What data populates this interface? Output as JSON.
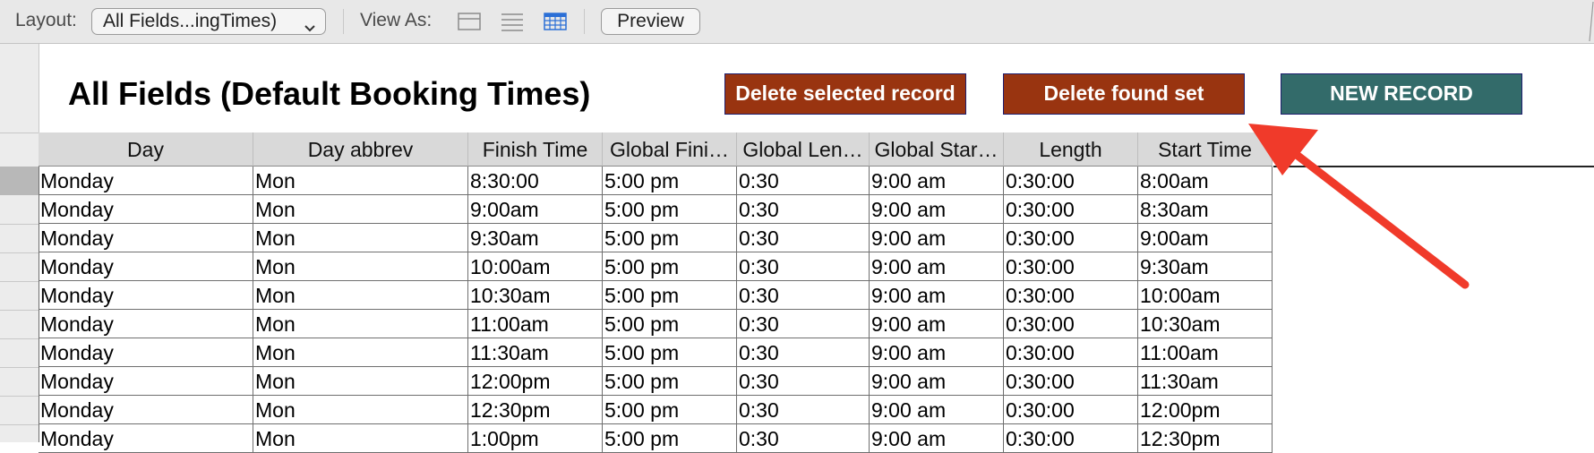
{
  "toolbar": {
    "layout_label": "Layout:",
    "layout_value": "All Fields...ingTimes)",
    "view_as_label": "View As:",
    "view_modes": [
      "form-view-icon",
      "list-view-icon",
      "table-view-icon"
    ],
    "selected_view": "table",
    "preview_label": "Preview"
  },
  "header": {
    "title": "All Fields (Default Booking Times)",
    "buttons": {
      "delete_selected": "Delete selected record",
      "delete_found": "Delete found set",
      "new_record": "NEW RECORD"
    }
  },
  "colors": {
    "delete_button_bg": "#993410",
    "new_record_bg": "#336b6a",
    "button_border": "#1e1e6e",
    "selected_view_icon": "#2b6fd6",
    "annotation_arrow": "#f03a2a"
  },
  "table": {
    "columns": [
      "Day",
      "Day abbrev",
      "Finish Time",
      "Global Fini…",
      "Global Len…",
      "Global Star…",
      "Length",
      "Start Time"
    ],
    "rows": [
      [
        "Monday",
        "Mon",
        "8:30:00",
        "5:00 pm",
        "0:30",
        "9:00 am",
        "0:30:00",
        "8:00am"
      ],
      [
        "Monday",
        "Mon",
        "9:00am",
        "5:00 pm",
        "0:30",
        "9:00 am",
        "0:30:00",
        "8:30am"
      ],
      [
        "Monday",
        "Mon",
        "9:30am",
        "5:00 pm",
        "0:30",
        "9:00 am",
        "0:30:00",
        "9:00am"
      ],
      [
        "Monday",
        "Mon",
        "10:00am",
        "5:00 pm",
        "0:30",
        "9:00 am",
        "0:30:00",
        "9:30am"
      ],
      [
        "Monday",
        "Mon",
        "10:30am",
        "5:00 pm",
        "0:30",
        "9:00 am",
        "0:30:00",
        "10:00am"
      ],
      [
        "Monday",
        "Mon",
        "11:00am",
        "5:00 pm",
        "0:30",
        "9:00 am",
        "0:30:00",
        "10:30am"
      ],
      [
        "Monday",
        "Mon",
        "11:30am",
        "5:00 pm",
        "0:30",
        "9:00 am",
        "0:30:00",
        "11:00am"
      ],
      [
        "Monday",
        "Mon",
        "12:00pm",
        "5:00 pm",
        "0:30",
        "9:00 am",
        "0:30:00",
        "11:30am"
      ],
      [
        "Monday",
        "Mon",
        "12:30pm",
        "5:00 pm",
        "0:30",
        "9:00 am",
        "0:30:00",
        "12:00pm"
      ],
      [
        "Monday",
        "Mon",
        "1:00pm",
        "5:00 pm",
        "0:30",
        "9:00 am",
        "0:30:00",
        "12:30pm"
      ]
    ]
  }
}
